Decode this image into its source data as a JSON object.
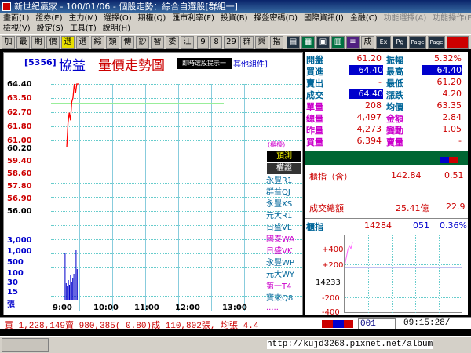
{
  "window": {
    "title": "新世紀贏家 - 100/01/06 - 個股走勢：綜合自選股[群組一]"
  },
  "menu": {
    "row1": [
      "畫面(L)",
      "證券(E)",
      "主力(M)",
      "選擇(O)",
      "期權(Q)",
      "匯市利率(F)",
      "投資(B)",
      "操盤密碼(D)",
      "國際資訊(I)",
      "金融(C)",
      "功能選擇(A)",
      "功能操作(F)"
    ],
    "row2": [
      "檢視(V)",
      "設定(S)",
      "工具(T)",
      "說明(H)"
    ]
  },
  "toolbar": {
    "buttons": [
      "加",
      "最",
      "期",
      "價",
      "選",
      "選",
      "綜",
      "類",
      "傳",
      "鈔",
      "智",
      "委",
      "江",
      "9",
      "8",
      "29",
      "群",
      "興",
      "指"
    ],
    "right_buttons": [
      "成",
      "Ex",
      "Pg",
      "Page",
      "Page"
    ]
  },
  "stock": {
    "code": "[5356]",
    "name": "協益",
    "chart_title": "量價走勢圖",
    "tooltip": "即時選股提示一",
    "group_label": "其他組件]"
  },
  "chart": {
    "price_ticks": [
      "64.40",
      "63.50",
      "62.70",
      "61.80",
      "61.00",
      "60.20",
      "59.40",
      "58.60",
      "57.80",
      "56.90",
      "56.00"
    ],
    "volume_ticks": [
      "3,000",
      "1,000",
      "500",
      "100",
      "30",
      "15",
      "張"
    ],
    "time_ticks": [
      "9:00",
      "10:00",
      "11:00",
      "12:00",
      "13:00"
    ],
    "legend_tag": "(櫃檯)",
    "chart_data": {
      "type": "line",
      "x": [
        "9:00",
        "9:01",
        "9:02",
        "9:03",
        "9:04",
        "9:05",
        "9:06",
        "9:07",
        "9:08",
        "9:09",
        "9:10"
      ],
      "values": [
        60.2,
        61.8,
        62.5,
        62.0,
        63.2,
        63.5,
        64.4,
        63.8,
        64.4,
        64.4,
        64.4
      ],
      "ylim": [
        56.0,
        64.4
      ]
    }
  },
  "brokers": {
    "header1": "預測",
    "header2": "權證",
    "items": [
      "永豐R1",
      "群益QJ",
      "永豐XS",
      "元大R1",
      "日盛VL",
      "國泰WA",
      "日盛VK",
      "永豐WP",
      "元大WY",
      "第一T4",
      "寶來Q8",
      "·····"
    ]
  },
  "quote": {
    "open_label": "開盤",
    "open": "61.20",
    "amp_label": "振幅",
    "amp": "5.32%",
    "bid_label": "買進",
    "bid": "64.40",
    "high_label": "最高",
    "high": "64.40",
    "ask_label": "賣出",
    "ask": "-",
    "low_label": "最低",
    "low": "61.20",
    "deal_label": "成交",
    "deal": "64.40",
    "change_label": "漲跌",
    "change": "4.20",
    "unitvol_label": "單量",
    "unitvol": "208",
    "avg_label": "均價",
    "avg": "63.35",
    "totalvol_label": "總量",
    "totalvol": "4,497",
    "amount_label": "金額",
    "amount": "2.84",
    "yvol_label": "昨量",
    "yvol": "4,273",
    "varchg_label": "變動",
    "varchg": "1.05",
    "buyvol_label": "買量",
    "buyvol": "6,394",
    "sellvol_label": "賣量",
    "sellvol": "-"
  },
  "otc": {
    "label": "櫃指（含）",
    "value": "142.84",
    "chg": "0.51",
    "total_label": "成交總額",
    "total": "25.41億",
    "total2": "22.9",
    "mini_label": "櫃指",
    "mini_val": "14284",
    "mini_chg": "051",
    "mini_pct": "0.36%",
    "mini_ticks": [
      "+400",
      "+200",
      "14233",
      "-200",
      "-400"
    ]
  },
  "status": {
    "text": "買 1,228,149賣 980,385( 0.80)成 110,802張, 均張 4.4",
    "input": "001",
    "time": "09:15:28/"
  },
  "watermark": "http://kujd3268.pixnet.net/album"
}
